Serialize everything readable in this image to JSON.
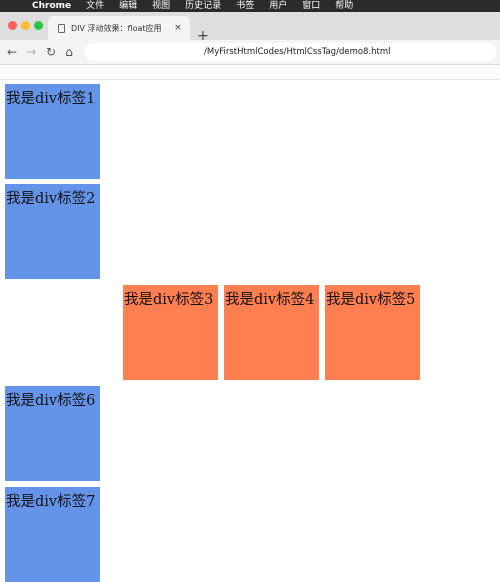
{
  "menubar": {
    "apple": "",
    "items": [
      "Chrome",
      "文件",
      "编辑",
      "视图",
      "历史记录",
      "书签",
      "用户",
      "窗口",
      "帮助"
    ]
  },
  "tab": {
    "title": "DIV 浮动效果：float应用",
    "close": "×",
    "new_tab": "+"
  },
  "toolbar": {
    "back": "←",
    "forward": "→",
    "reload": "↻",
    "home": "⌂",
    "url": "/MyFirstHtmlCodes/HtmlCssTag/demo8.html"
  },
  "colors": {
    "blue": "#6494ea",
    "orange": "#ff7f50"
  },
  "boxes": [
    {
      "label": "我是div标签1",
      "color": "blue"
    },
    {
      "label": "我是div标签2",
      "color": "blue"
    },
    {
      "label": "我是div标签3",
      "color": "orange"
    },
    {
      "label": "我是div标签4",
      "color": "orange"
    },
    {
      "label": "我是div标签5",
      "color": "orange"
    },
    {
      "label": "我是div标签6",
      "color": "blue"
    },
    {
      "label": "我是div标签7",
      "color": "blue"
    }
  ]
}
